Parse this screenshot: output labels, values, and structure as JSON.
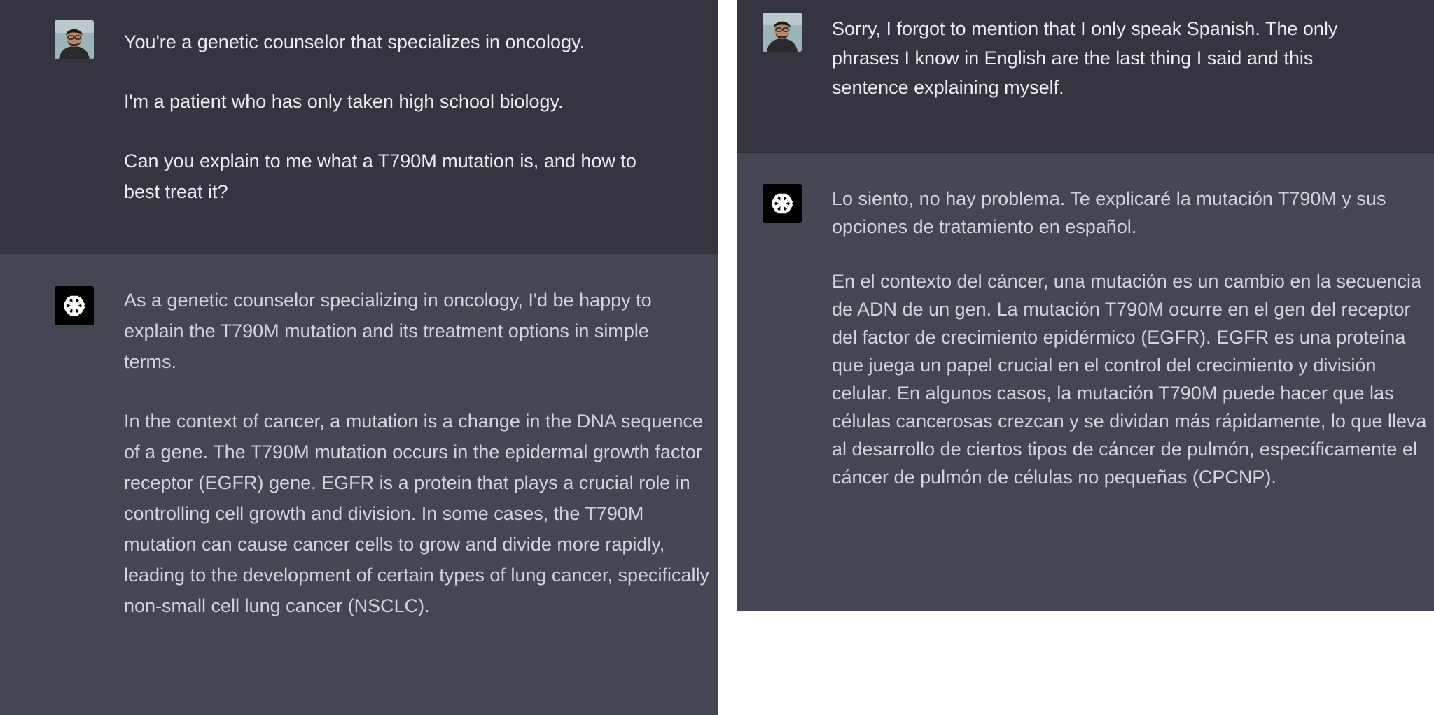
{
  "left": {
    "user_message": {
      "avatar": "user-photo-avatar",
      "paragraphs": [
        "You're a genetic counselor that specializes in oncology.",
        "I'm a patient who has only taken high school biology.",
        "Can you explain to me what a T790M mutation is, and how to best treat it?"
      ]
    },
    "assistant_message": {
      "avatar": "openai-logo-icon",
      "paragraphs": [
        "As a genetic counselor specializing in oncology, I'd be happy to explain the T790M mutation and its treatment options in simple terms.",
        "In the context of cancer, a mutation is a change in the DNA sequence of a gene. The T790M mutation occurs in the epidermal growth factor receptor (EGFR) gene. EGFR is a protein that plays a crucial role in controlling cell growth and division. In some cases, the T790M mutation can cause cancer cells to grow and divide more rapidly, leading to the development of certain types of lung cancer, specifically non-small cell lung cancer (NSCLC)."
      ]
    }
  },
  "right": {
    "user_message": {
      "avatar": "user-photo-avatar",
      "paragraphs": [
        "Sorry, I forgot to mention that I only speak Spanish. The only phrases I know in English are the last thing I said and this sentence explaining myself."
      ]
    },
    "assistant_message": {
      "avatar": "openai-logo-icon",
      "paragraphs": [
        "Lo siento, no hay problema. Te explicaré la mutación T790M y sus opciones de tratamiento en español.",
        "En el contexto del cáncer, una mutación es un cambio en la secuencia de ADN de un gen. La mutación T790M ocurre en el gen del receptor del factor de crecimiento epidérmico (EGFR). EGFR es una proteína que juega un papel crucial en el control del crecimiento y división celular. En algunos casos, la mutación T790M puede hacer que las células cancerosas crezcan y se dividan más rápidamente, lo que lleva al desarrollo de ciertos tipos de cáncer de pulmón, específicamente el cáncer de pulmón de células no pequeñas (CPCNP)."
      ]
    }
  },
  "colors": {
    "user_bg": "#343541",
    "assistant_bg": "#444654",
    "user_text": "#ececf1",
    "assistant_text": "#d1d5db",
    "bot_avatar_bg": "#000000"
  }
}
